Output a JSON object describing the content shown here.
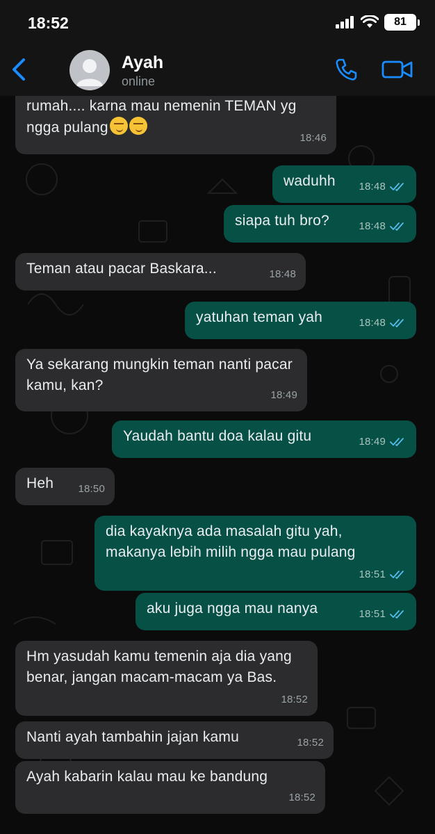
{
  "status": {
    "time": "18:52",
    "battery": "81"
  },
  "header": {
    "contact_name": "Ayah",
    "contact_status": "online"
  },
  "messages": [
    {
      "dir": "in",
      "text": "Kata bunda ada yang ngga pulang ke rumah.... karna mau nemenin TEMAN yg ngga pulang",
      "emoji": "😏😏",
      "time": "18:46"
    },
    {
      "dir": "out",
      "text": "waduhh",
      "time": "18:48"
    },
    {
      "dir": "out",
      "text": "siapa tuh bro?",
      "time": "18:48"
    },
    {
      "dir": "in",
      "text": "Teman atau pacar Baskara...",
      "time": "18:48"
    },
    {
      "dir": "out",
      "text": "yatuhan teman yah",
      "time": "18:48"
    },
    {
      "dir": "in",
      "text": "Ya sekarang mungkin teman nanti pacar kamu, kan?",
      "time": "18:49"
    },
    {
      "dir": "out",
      "text": "Yaudah bantu doa kalau gitu",
      "time": "18:49"
    },
    {
      "dir": "in",
      "text": "Heh",
      "time": "18:50"
    },
    {
      "dir": "out",
      "text": "dia kayaknya ada masalah gitu yah, makanya lebih milih ngga mau pulang",
      "time": "18:51"
    },
    {
      "dir": "out",
      "text": "aku juga ngga mau nanya",
      "time": "18:51"
    },
    {
      "dir": "in",
      "text": "Hm yasudah kamu temenin aja dia yang benar, jangan macam-macam ya Bas.",
      "time": "18:52"
    },
    {
      "dir": "in",
      "text": "Nanti ayah tambahin jajan kamu",
      "time": "18:52"
    },
    {
      "dir": "in",
      "text": "Ayah kabarin kalau mau ke bandung",
      "time": "18:52"
    }
  ],
  "icons": {
    "back": "chevron-left-icon",
    "call": "phone-icon",
    "video": "video-camera-icon",
    "read": "double-check-icon"
  },
  "colors": {
    "accent": "#1a8cff",
    "outgoing_bubble": "#075046",
    "incoming_bubble": "#2c2c2e",
    "read_ticks": "#53bdeb"
  }
}
